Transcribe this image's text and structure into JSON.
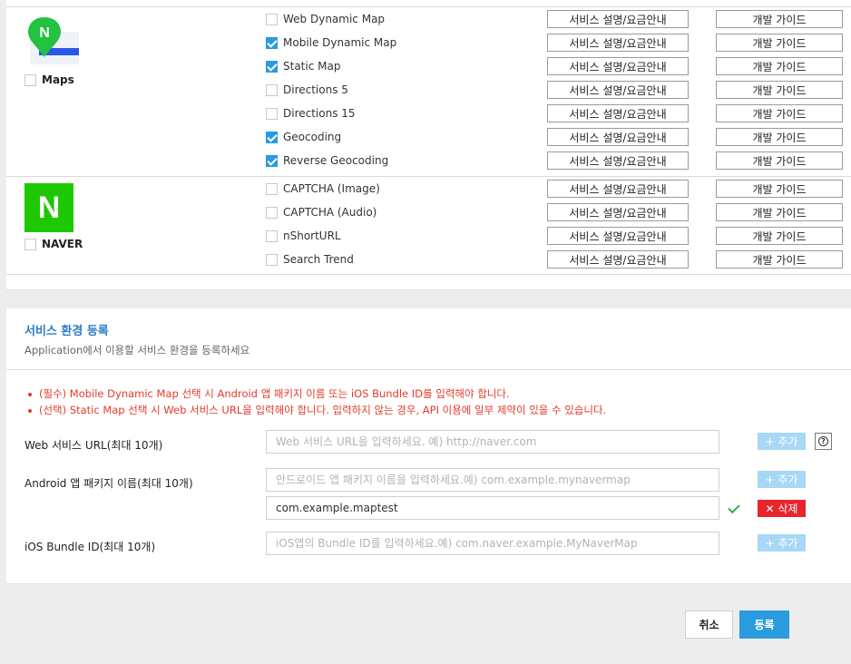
{
  "maps": {
    "group_label": "Maps",
    "group_checked": false,
    "services": [
      {
        "name": "Web Dynamic Map",
        "checked": false
      },
      {
        "name": "Mobile Dynamic Map",
        "checked": true
      },
      {
        "name": "Static Map",
        "checked": true
      },
      {
        "name": "Directions 5",
        "checked": false
      },
      {
        "name": "Directions 15",
        "checked": false
      },
      {
        "name": "Geocoding",
        "checked": true
      },
      {
        "name": "Reverse Geocoding",
        "checked": true
      }
    ]
  },
  "naver": {
    "group_label": "NAVER",
    "logo_letter": "N",
    "group_checked": false,
    "services": [
      {
        "name": "CAPTCHA (Image)",
        "checked": false
      },
      {
        "name": "CAPTCHA (Audio)",
        "checked": false
      },
      {
        "name": "nShortURL",
        "checked": false
      },
      {
        "name": "Search Trend",
        "checked": false
      }
    ]
  },
  "row_buttons": {
    "info_label": "서비스 설명/요금안내",
    "guide_label": "개발 가이드"
  },
  "env": {
    "title": "서비스 환경 등록",
    "subtitle": "Application에서 이용할 서비스 환경을 등록하세요",
    "notice_1": "(필수) Mobile Dynamic Map 선택 시 Android 앱 패키지 이름 또는 iOS Bundle ID를 입력해야 합니다.",
    "notice_2": "(선택) Static Map 선택 시 Web 서비스 URL을 입력해야 합니다. 입력하지 않는 경우, API 이용에 일부 제약이 있을 수 있습니다.",
    "web_label": "Web 서비스 URL(최대 10개)",
    "web_placeholder": "Web 서비스 URL을 입력하세요. 예) http://naver.com",
    "android_label": "Android 앱 패키지 이름(최대 10개)",
    "android_placeholder": "안드로이드 앱 패키지 이름을 입력하세요.예) com.example.mynavermap",
    "android_value": "com.example.maptest",
    "ios_label": "iOS Bundle ID(최대 10개)",
    "ios_placeholder": "iOS앱의 Bundle ID를 입력하세요.예) com.naver.example.MyNaverMap",
    "add_label": "+ 추가",
    "delete_label": "✕ 삭제",
    "help_glyph": "?"
  },
  "footer": {
    "cancel_label": "취소",
    "submit_label": "등록"
  },
  "colors": {
    "accent": "#2b9be0",
    "naver_green": "#1ec800",
    "notice_red": "#e23b2b",
    "delete_red": "#e8242d"
  }
}
